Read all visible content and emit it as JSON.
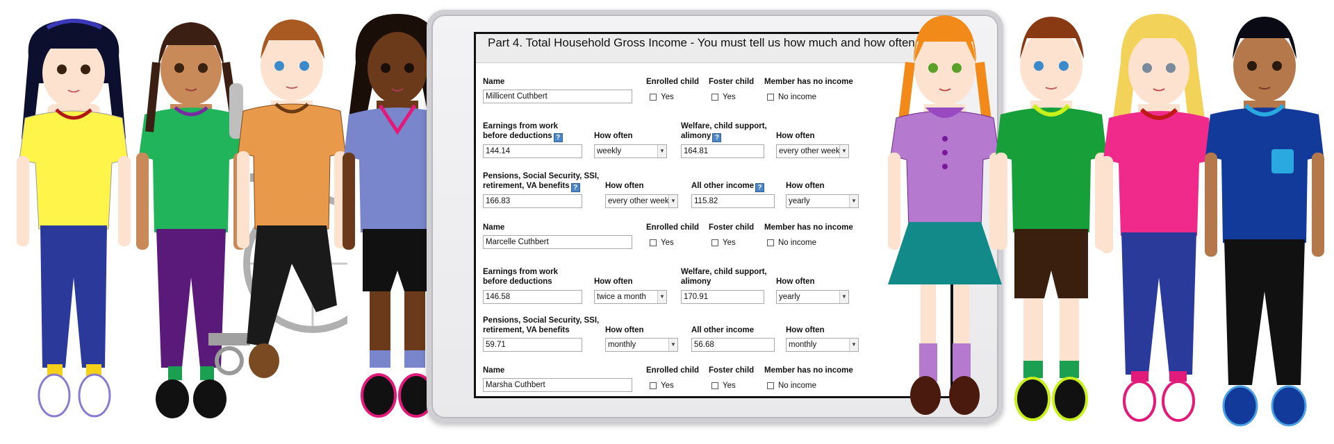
{
  "form": {
    "title": "Part 4. Total Household Gross Income - You must tell us how much and how often",
    "labels": {
      "name": "Name",
      "enrolled_child": "Enrolled child",
      "foster_child": "Foster child",
      "no_income": "Member has no income",
      "earnings_line1": "Earnings from work",
      "earnings_line2": "before deductions",
      "how_often": "How often",
      "welfare_line1": "Welfare, child support,",
      "welfare_line2": "alimony",
      "pensions_line1": "Pensions, Social Security, SSI,",
      "pensions_line2": "retirement, VA benefits",
      "other_income": "All other income",
      "yes": "Yes",
      "no_income_option": "No income",
      "help": "?"
    },
    "members": [
      {
        "name": "Millicent Cuthbert",
        "earnings": "144.14",
        "earnings_freq": "weekly",
        "welfare": "164.81",
        "welfare_freq": "every other week",
        "pensions": "166.83",
        "pensions_freq": "every other week",
        "other": "115.82",
        "other_freq": "yearly"
      },
      {
        "name": "Marcelle Cuthbert",
        "earnings": "146.58",
        "earnings_freq": "twice a month",
        "welfare": "170.91",
        "welfare_freq": "yearly",
        "pensions": "59.71",
        "pensions_freq": "monthly",
        "other": "56.68",
        "other_freq": "monthly"
      },
      {
        "name": "Marsha Cuthbert"
      }
    ]
  },
  "characters": [
    {
      "name": "girl-dark-hair-yellow-shirt",
      "shirt": "#fff44a",
      "pants": "#2b3a9a",
      "skin": "#fde3cf",
      "hair": "#0c0f2e"
    },
    {
      "name": "girl-braids-green-shirt",
      "shirt": "#21b45a",
      "pants": "#5a1a7a",
      "skin": "#c98a5a",
      "hair": "#3a1f12"
    },
    {
      "name": "boy-orange-shirt-wheelchair",
      "shirt": "#e89a4a",
      "pants": "#1a1a1a",
      "skin": "#fde3cf",
      "hair": "#a85a22"
    },
    {
      "name": "girl-curly-hair-blue-shirt",
      "shirt": "#7a86cc",
      "pants": "#111111",
      "skin": "#6b3a1a",
      "hair": "#1a0e08"
    },
    {
      "name": "girl-red-hair-purple-dress",
      "shirt": "#b57ad0",
      "pants": "#138a8a",
      "skin": "#fde3cf",
      "hair": "#f28a1a"
    },
    {
      "name": "boy-green-shirt",
      "shirt": "#17a03a",
      "pants": "#3a1f0e",
      "skin": "#fde3cf",
      "hair": "#8a3a12"
    },
    {
      "name": "girl-blonde-pink-shirt",
      "shirt": "#f02a8a",
      "pants": "#2a3a9a",
      "skin": "#fde3cf",
      "hair": "#f3d25a"
    },
    {
      "name": "boy-navy-shirt",
      "shirt": "#123a9a",
      "pants": "#111111",
      "skin": "#b5784a",
      "hair": "#0a0a14"
    }
  ]
}
